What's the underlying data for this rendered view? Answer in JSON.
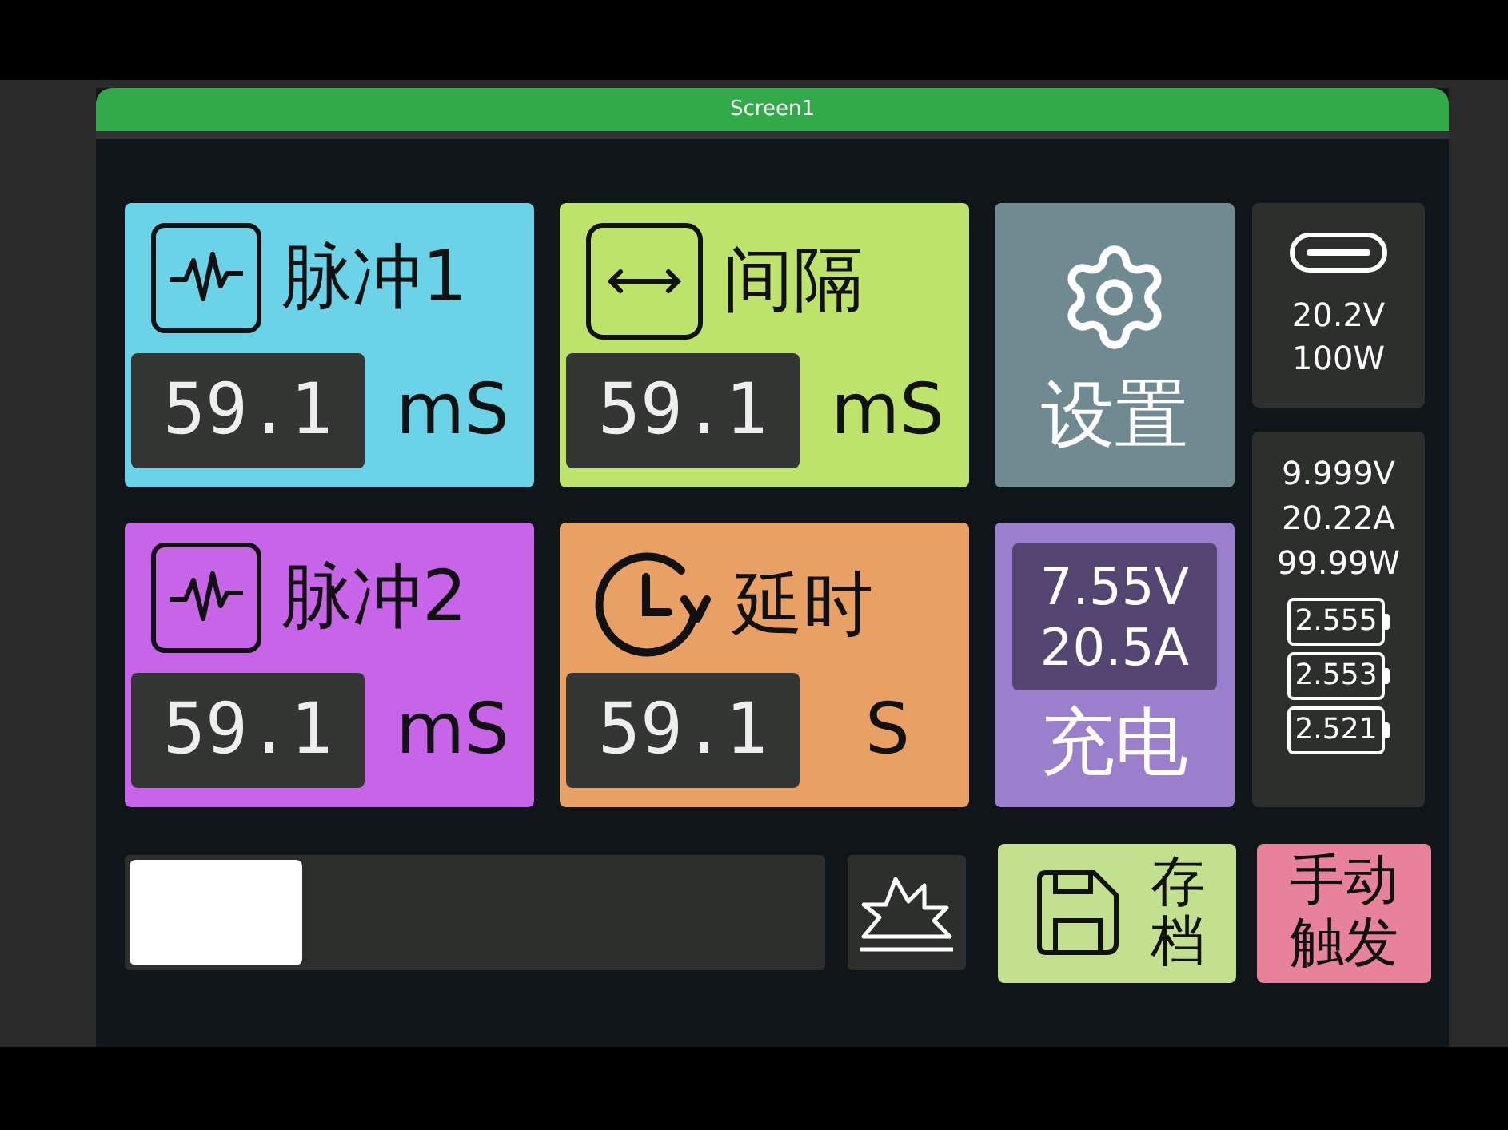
{
  "window": {
    "title": "Screen1"
  },
  "tiles": [
    {
      "kind": "timer",
      "label": "脉冲1",
      "value": "59.1",
      "unit": "mS",
      "color": "#6ad3e8"
    },
    {
      "kind": "timer",
      "label": "间隔",
      "value": "59.1",
      "unit": "mS",
      "color": "#bde36a"
    },
    {
      "kind": "settings",
      "label": "设置",
      "color": "#6f8a90"
    },
    {
      "kind": "timer",
      "label": "脉冲2",
      "value": "59.1",
      "unit": "mS",
      "color": "#c764e8"
    },
    {
      "kind": "timer",
      "label": "延时",
      "value": "59.1",
      "unit": "S",
      "color": "#e9a064"
    },
    {
      "kind": "charge",
      "voltage": "7.55V",
      "current": "20.5A",
      "label": "充电",
      "color": "#9a7fcc"
    }
  ],
  "usb": {
    "voltage": "20.2V",
    "power": "100W"
  },
  "stats": {
    "readings": [
      "9.999V",
      "20.22A",
      "99.99W"
    ],
    "cells": [
      "2.555",
      "2.553",
      "2.521"
    ]
  },
  "progress": {
    "level": 0.25
  },
  "save_button": {
    "label": "存档"
  },
  "trigger_button": {
    "label": "手动触发"
  }
}
